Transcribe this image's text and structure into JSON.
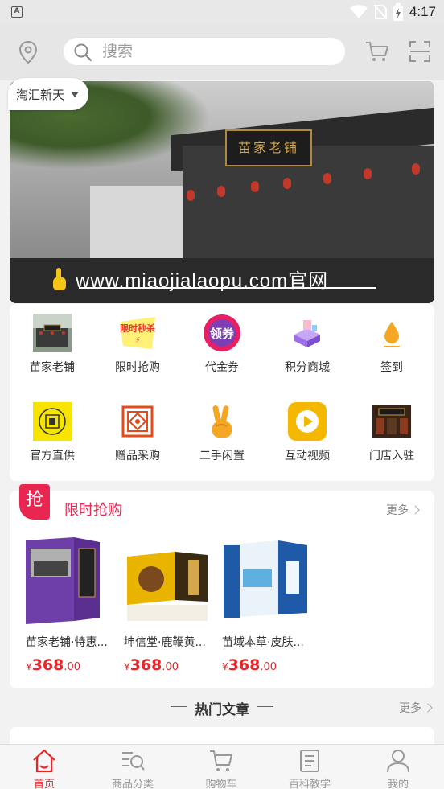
{
  "status": {
    "time": "4:17"
  },
  "header": {
    "search_placeholder": "搜索",
    "location_label": "淘汇新天"
  },
  "banner": {
    "url_text": "www.miaojialaopu.com官网",
    "sign_text": "苗家老铺"
  },
  "grid": {
    "items": [
      {
        "label": "苗家老铺",
        "icon": "store-photo-icon"
      },
      {
        "label": "限时抢购",
        "icon": "flash-sale-icon"
      },
      {
        "label": "代金券",
        "icon": "coupon-icon"
      },
      {
        "label": "积分商城",
        "icon": "points-mall-icon"
      },
      {
        "label": "签到",
        "icon": "checkin-drop-icon"
      },
      {
        "label": "官方直供",
        "icon": "official-supply-icon"
      },
      {
        "label": "赠品采购",
        "icon": "gift-purchase-icon"
      },
      {
        "label": "二手闲置",
        "icon": "victory-hand-icon"
      },
      {
        "label": "互动视频",
        "icon": "video-play-icon"
      },
      {
        "label": "门店入驻",
        "icon": "shop-entry-icon"
      }
    ],
    "coupon_text": "领券",
    "flash_text": "限时秒杀"
  },
  "flash_sale": {
    "badge": "抢",
    "title": "限时抢购",
    "more": "更多",
    "products": [
      {
        "name": "苗家老铺·特惠...",
        "currency": "¥",
        "price_int": "368",
        "price_dec": ".00"
      },
      {
        "name": "坤信堂·鹿鞭黄...",
        "currency": "¥",
        "price_int": "368",
        "price_dec": ".00"
      },
      {
        "name": "苗域本草·皮肤...",
        "currency": "¥",
        "price_int": "368",
        "price_dec": ".00"
      }
    ]
  },
  "hot_articles": {
    "title": "热门文章",
    "more": "更多"
  },
  "tabbar": {
    "tabs": [
      {
        "label": "首页",
        "active": true
      },
      {
        "label": "商品分类",
        "active": false
      },
      {
        "label": "购物车",
        "active": false
      },
      {
        "label": "百科教学",
        "active": false
      },
      {
        "label": "我的",
        "active": false
      }
    ]
  },
  "colors": {
    "accent": "#e8264f",
    "price": "#e8262a"
  }
}
